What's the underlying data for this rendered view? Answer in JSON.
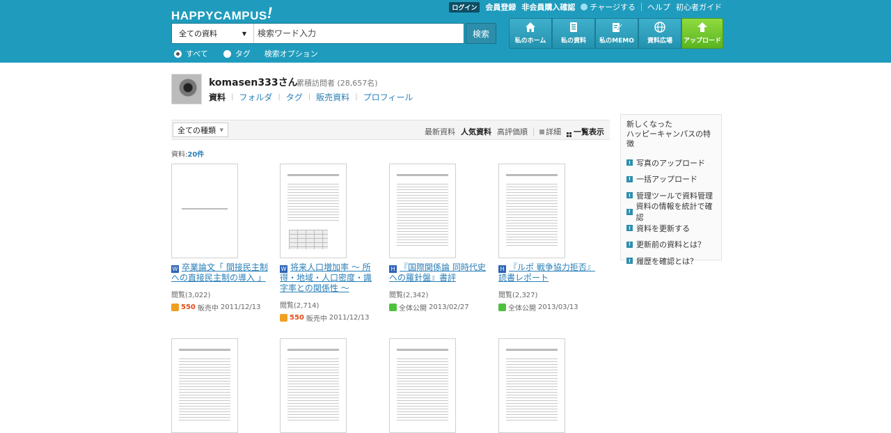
{
  "header": {
    "logo": "HAPPYCAMPUS",
    "logo_mark": "!",
    "top_links": {
      "login": "ログイン",
      "register": "会員登録",
      "guest_purchase": "非会員購入確認",
      "charge": "チャージする",
      "help": "ヘルプ",
      "beginner": "初心者ガイド"
    },
    "search": {
      "category": "全ての資料",
      "placeholder": "検索ワード入力",
      "button": "検索"
    },
    "radios": {
      "all": "すべて",
      "tag": "タグ",
      "options": "検索オプション"
    },
    "nav": [
      {
        "label": "私のホーム",
        "icon": "home-icon"
      },
      {
        "label": "私の資料",
        "icon": "document-icon"
      },
      {
        "label": "私のMEMO",
        "icon": "memo-icon"
      },
      {
        "label": "資料広場",
        "icon": "globe-icon"
      },
      {
        "label": "アップロード",
        "icon": "upload-arrow-icon"
      }
    ]
  },
  "profile": {
    "name": "komasen333さん",
    "visits": "累積訪問者 (28,657名)",
    "tabs": [
      "資料",
      "フォルダ",
      "タグ",
      "販売資料",
      "プロフィール"
    ]
  },
  "toolbar": {
    "type_select": "全ての種類",
    "sorts": [
      "最新資料",
      "人気資料",
      "高評価順"
    ],
    "view_detail": "詳細",
    "view_list": "一覧表示"
  },
  "count": {
    "label": "資料:",
    "value": "20件"
  },
  "items": [
    {
      "title": "卒業論文「 間接民主制への直接民主制の導入 」",
      "views": "閲覧(3,022)",
      "price": "550",
      "status": "販売中",
      "date": "2011/12/13"
    },
    {
      "title": "将来人口増加率 ～ 所得・地域・人口密度・識字率との関係性 ～",
      "views": "閲覧(2,714)",
      "price": "550",
      "status": "販売中",
      "date": "2011/12/13"
    },
    {
      "title": "『国際関係論 同時代史への羅針盤』書評",
      "views": "閲覧(2,342)",
      "status": "全体公開",
      "date": "2013/02/27"
    },
    {
      "title": "『ルポ 戦争協力拒否』読書レポート",
      "views": "閲覧(2,327)",
      "status": "全体公開",
      "date": "2013/03/13"
    }
  ],
  "sidebar": {
    "heading": "新しくなった\nハッピーキャンパスの特徴",
    "items": [
      "写真のアップロード",
      "一括アップロード",
      "管理ツールで資料管理",
      "資料の情報を統計で確認",
      "資料を更新する",
      "更新前の資料とは？",
      "履歴を確認とは？"
    ]
  },
  "colors": {
    "header": "#1f9cbd",
    "link": "#2a7fb8",
    "upload": "#5ab41f",
    "price": "#e24b1a"
  }
}
